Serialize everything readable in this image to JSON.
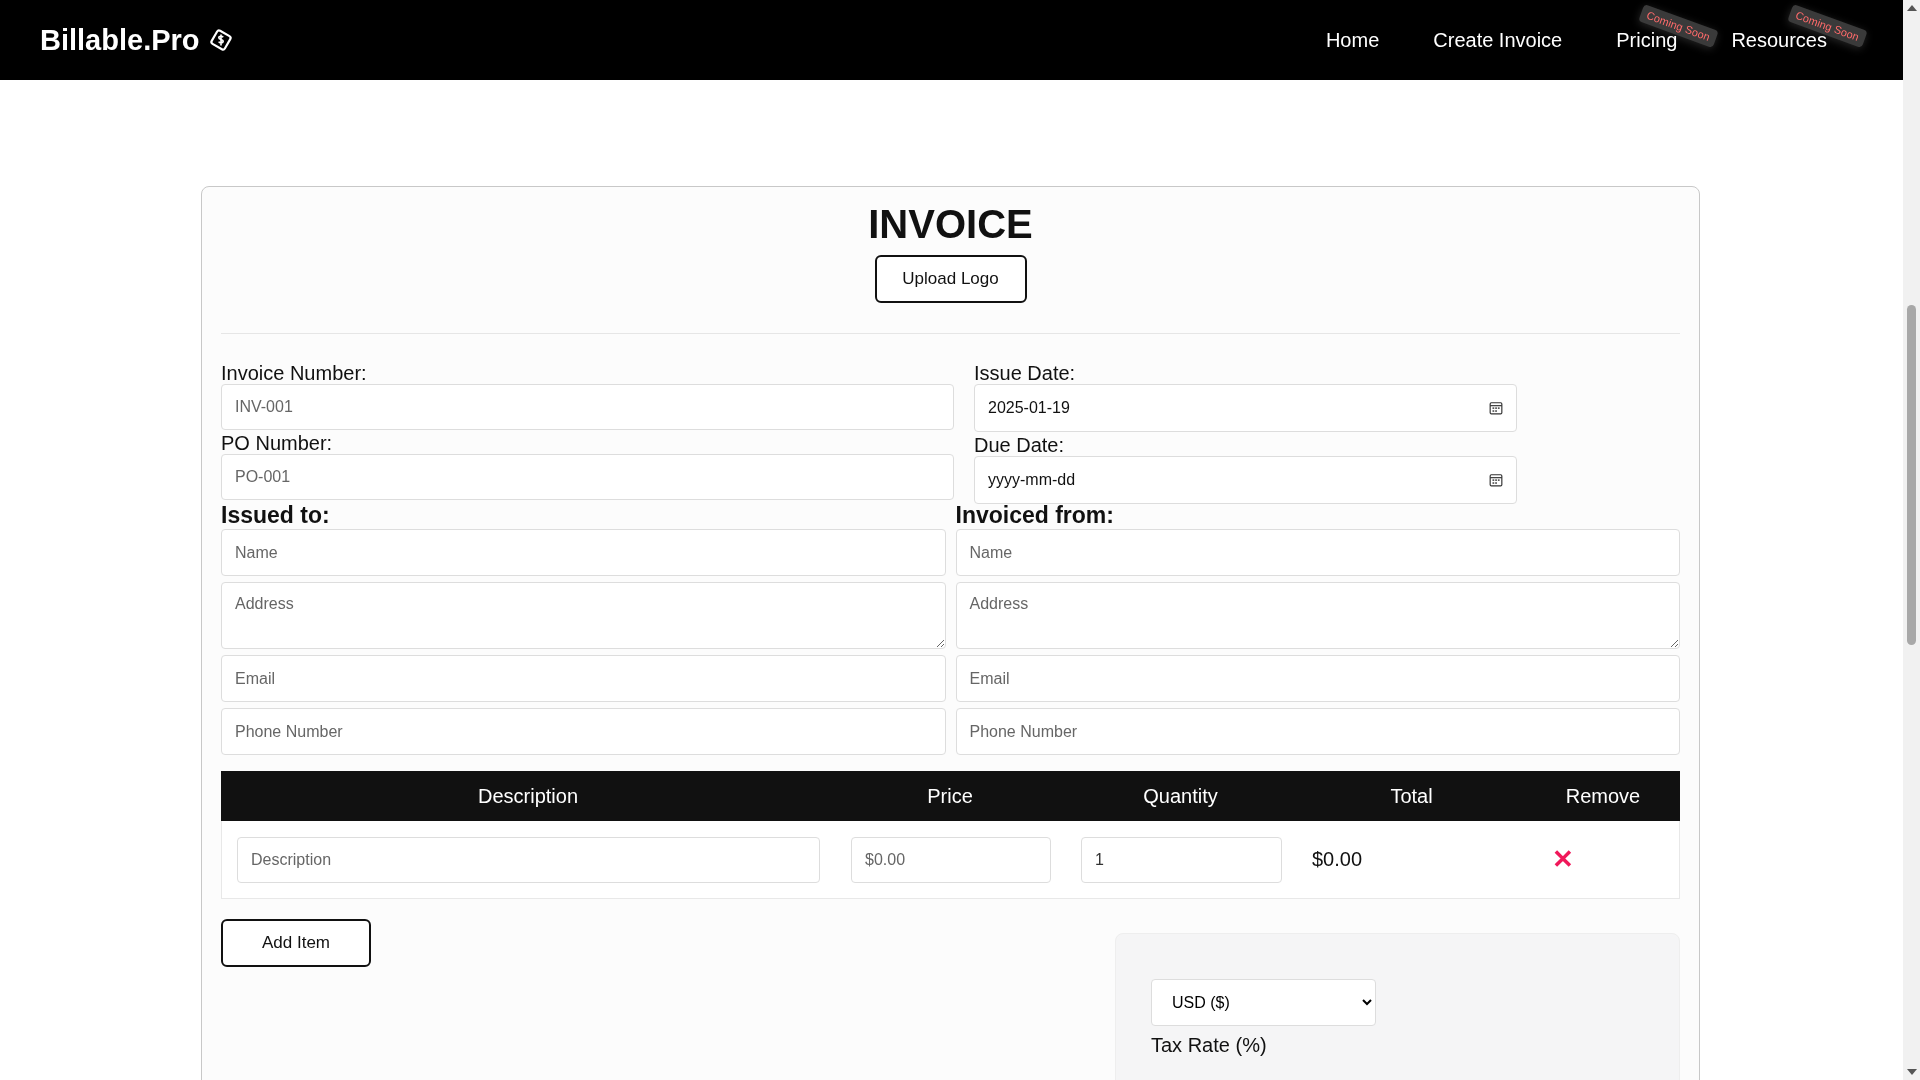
{
  "header": {
    "brand": "Billable.Pro",
    "nav": [
      {
        "label": "Home"
      },
      {
        "label": "Create Invoice"
      },
      {
        "label": "Pricing",
        "badge": "Coming Soon"
      },
      {
        "label": "Resources",
        "badge": "Coming Soon"
      }
    ]
  },
  "invoice": {
    "title": "INVOICE",
    "upload_button": "Upload Logo",
    "meta_left": [
      {
        "label": "Invoice Number:",
        "placeholder": "INV-001"
      },
      {
        "label": "PO Number:",
        "placeholder": "PO-001"
      }
    ],
    "meta_right": [
      {
        "label": "Issue Date:",
        "value": "2025-01-19"
      },
      {
        "label": "Due Date:",
        "value": "yyyy-mm-dd"
      }
    ],
    "parties": [
      {
        "heading": "Issued to:",
        "fields": [
          {
            "kind": "text",
            "placeholder": "Name"
          },
          {
            "kind": "textarea",
            "placeholder": "Address"
          },
          {
            "kind": "text",
            "placeholder": "Email"
          },
          {
            "kind": "text",
            "placeholder": "Phone Number"
          }
        ]
      },
      {
        "heading": "Invoiced from:",
        "fields": [
          {
            "kind": "text",
            "placeholder": "Name"
          },
          {
            "kind": "textarea",
            "placeholder": "Address"
          },
          {
            "kind": "text",
            "placeholder": "Email"
          },
          {
            "kind": "text",
            "placeholder": "Phone Number"
          }
        ]
      }
    ],
    "items_table": {
      "columns": [
        "Description",
        "Price",
        "Quantity",
        "Total",
        "Remove"
      ],
      "rows": [
        {
          "description": {
            "placeholder": "Description"
          },
          "price": {
            "placeholder": "$0.00"
          },
          "quantity": {
            "value": "1"
          },
          "total": "$0.00",
          "remove": "✕"
        }
      ]
    },
    "add_item_button": "Add Item",
    "summary": {
      "currency": "USD ($)",
      "tax_rate_label": "Tax Rate (%)"
    }
  }
}
